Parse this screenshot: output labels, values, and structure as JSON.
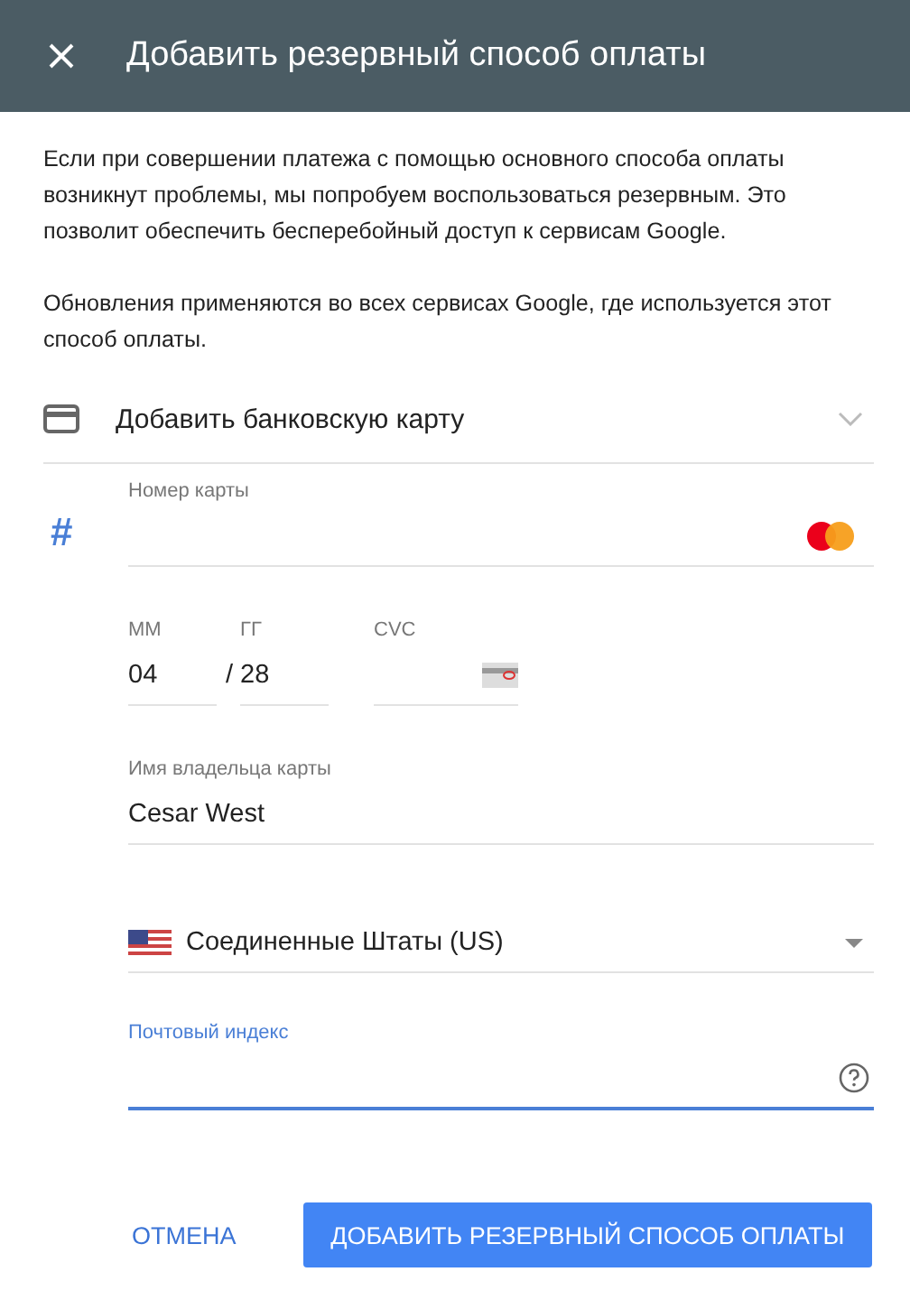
{
  "header": {
    "title": "Добавить резервный способ оплаты"
  },
  "paragraphs": [
    "Если при совершении платежа с помощью основного способа оплаты возникнут проблемы, мы попробуем воспользоваться резервным. Это позволит обеспечить бесперебойный доступ к сервисам Google.",
    "Обновления применяются во всех сервисах Google, где используется этот способ оплаты."
  ],
  "method": {
    "label": "Добавить банковскую карту"
  },
  "card_number": {
    "icon": "#",
    "label": "Номер карты"
  },
  "expiry": {
    "month_label": "ММ",
    "month": "04",
    "year_label": "ГГ",
    "separator": "/",
    "year": "28"
  },
  "cvc": {
    "label": "CVC"
  },
  "holder": {
    "label": "Имя владельца карты",
    "value": "Cesar West"
  },
  "country": {
    "value": "Соединенные Штаты (US)"
  },
  "postal": {
    "label": "Почтовый индекс",
    "focused": true
  },
  "buttons": {
    "cancel": "ОТМЕНА",
    "submit": "ДОБАВИТЬ РЕЗЕРВНЫЙ СПОСОБ ОПЛАТЫ"
  }
}
